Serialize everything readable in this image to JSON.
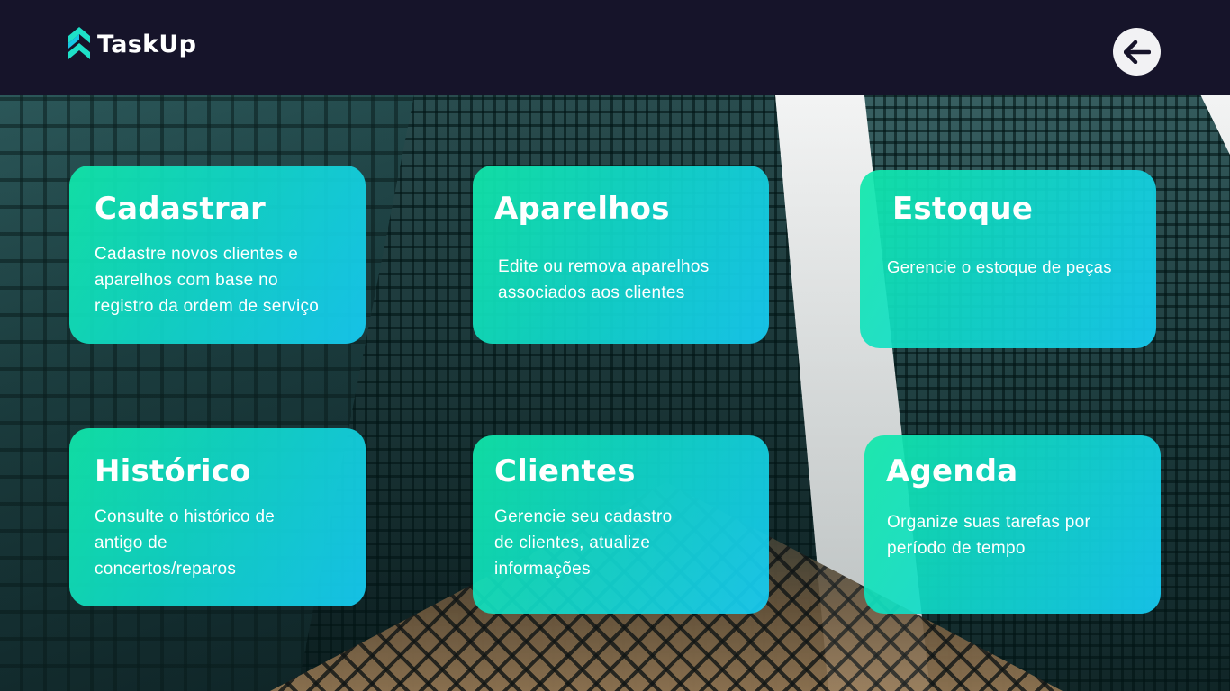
{
  "header": {
    "app_name": "TaskUp",
    "logo_icon": "double-chevron-up-icon",
    "back_icon": "arrow-left-icon"
  },
  "colors": {
    "header_bg": "#16142a",
    "card_green": "#10e8aa",
    "card_blue": "#16ccf5",
    "back_button_bg": "#f2f2f4"
  },
  "cards": [
    {
      "title": "Cadastrar",
      "description": "Cadastre novos clientes e\naparelhos com base no\nregistro da ordem de serviço"
    },
    {
      "title": "Aparelhos",
      "description": "Edite ou remova aparelhos\nassociados aos clientes"
    },
    {
      "title": "Estoque",
      "description": "Gerencie o estoque de peças"
    },
    {
      "title": "Histórico",
      "description": "Consulte o histórico de\nantigo de\nconcertos/reparos"
    },
    {
      "title": "Clientes",
      "description": "Gerencie seu cadastro\nde clientes, atualize\ninformações"
    },
    {
      "title": "Agenda",
      "description": "Organize suas tarefas por\nperíodo de tempo"
    }
  ]
}
